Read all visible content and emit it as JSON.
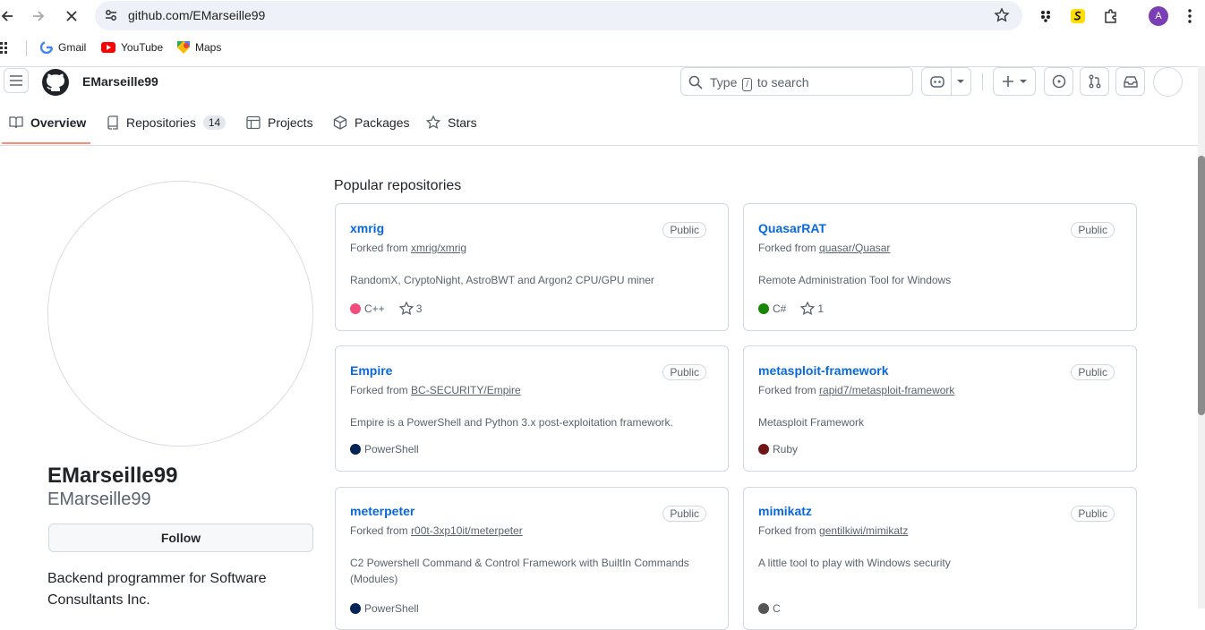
{
  "browser": {
    "url": "github.com/EMarseille99",
    "bookmarks": [
      {
        "label": "Gmail",
        "icon": "gmail-icon"
      },
      {
        "label": "YouTube",
        "icon": "youtube-icon"
      },
      {
        "label": "Maps",
        "icon": "maps-icon"
      }
    ],
    "profile_initial": "A"
  },
  "header": {
    "username": "EMarseille99",
    "search_prefix": "Type",
    "search_key": "/",
    "search_suffix": "to search"
  },
  "tabs": [
    {
      "label": "Overview",
      "icon": "book-icon",
      "active": true
    },
    {
      "label": "Repositories",
      "icon": "repo-icon",
      "count": "14"
    },
    {
      "label": "Projects",
      "icon": "table-icon"
    },
    {
      "label": "Packages",
      "icon": "package-icon"
    },
    {
      "label": "Stars",
      "icon": "star-icon"
    }
  ],
  "profile": {
    "name": "EMarseille99",
    "login": "EMarseille99",
    "follow_label": "Follow",
    "bio": "Backend programmer for Software Consultants Inc."
  },
  "popular": {
    "title": "Popular repositories",
    "repos": [
      {
        "name": "xmrig",
        "visibility": "Public",
        "fork_prefix": "Forked from",
        "fork_source": "xmrig/xmrig",
        "description": "RandomX, CryptoNight, AstroBWT and Argon2 CPU/GPU miner",
        "language": "C++",
        "lang_color": "#f34b7d",
        "stars": "3"
      },
      {
        "name": "QuasarRAT",
        "visibility": "Public",
        "fork_prefix": "Forked from",
        "fork_source": "quasar/Quasar",
        "description": "Remote Administration Tool for Windows",
        "language": "C#",
        "lang_color": "#178600",
        "stars": "1"
      },
      {
        "name": "Empire",
        "visibility": "Public",
        "fork_prefix": "Forked from",
        "fork_source": "BC-SECURITY/Empire",
        "description": "Empire is a PowerShell and Python 3.x post-exploitation framework.",
        "language": "PowerShell",
        "lang_color": "#012456",
        "stars": ""
      },
      {
        "name": "metasploit-framework",
        "visibility": "Public",
        "fork_prefix": "Forked from",
        "fork_source": "rapid7/metasploit-framework",
        "description": "Metasploit Framework",
        "language": "Ruby",
        "lang_color": "#701516",
        "stars": ""
      },
      {
        "name": "meterpeter",
        "visibility": "Public",
        "fork_prefix": "Forked from",
        "fork_source": "r00t-3xp10it/meterpeter",
        "description": "C2 Powershell Command & Control Framework with BuiltIn Commands (Modules)",
        "language": "PowerShell",
        "lang_color": "#012456",
        "stars": ""
      },
      {
        "name": "mimikatz",
        "visibility": "Public",
        "fork_prefix": "Forked from",
        "fork_source": "gentilkiwi/mimikatz",
        "description": "A little tool to play with Windows security",
        "language": "C",
        "lang_color": "#555555",
        "stars": ""
      }
    ]
  }
}
